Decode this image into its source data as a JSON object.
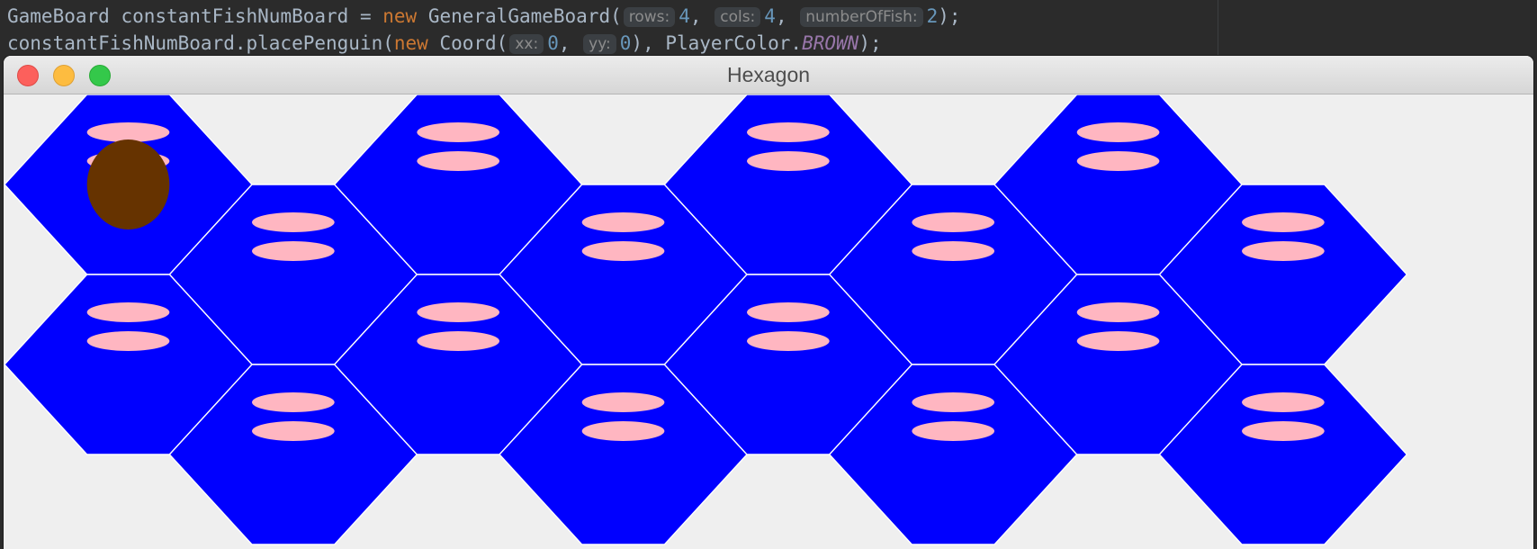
{
  "editor": {
    "line1": {
      "type": "GameBoard",
      "var": " constantFishNumBoard = ",
      "kw_new": "new",
      "ctor": " GeneralGameBoard(",
      "hint_rows": "rows:",
      "val_rows": "4",
      "hint_cols": "cols:",
      "val_cols": "4",
      "hint_fish": "numberOfFish:",
      "val_fish": "2",
      "end": ");"
    },
    "line2": {
      "start": "constantFishNumBoard.placePenguin(",
      "kw_new": "new",
      "ctor": " Coord(",
      "hint_xx": "xx:",
      "val_xx": "0",
      "hint_yy": "yy:",
      "val_yy": "0",
      "enum_prefix": " PlayerColor.",
      "enum_value": "BROWN",
      "end": ");"
    }
  },
  "window": {
    "title": "Hexagon"
  },
  "board": {
    "rows": 4,
    "cols": 4,
    "fish_per_tile": 2,
    "tile_color": "#0000ff",
    "tile_border_color": "#ffffff",
    "fish_color": "#ffb6c1",
    "background_color": "#efefef",
    "penguin": {
      "row": 0,
      "col": 0,
      "color": "#663300"
    }
  },
  "colors": {
    "close": "#fc605c",
    "minimize": "#fdbc40",
    "maximize": "#34c84a"
  }
}
